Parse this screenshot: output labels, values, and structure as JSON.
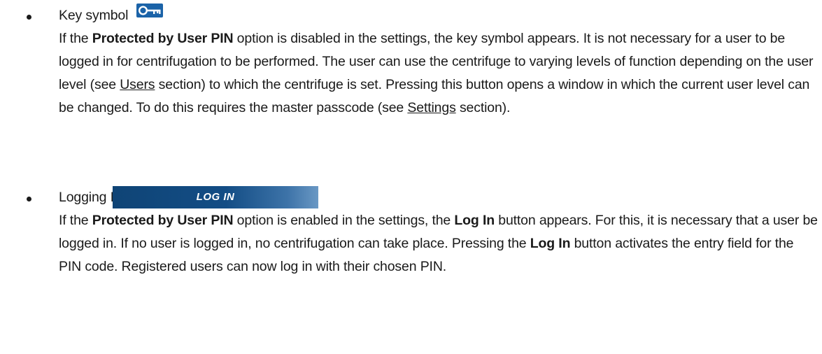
{
  "items": [
    {
      "title": "Key symbol",
      "icon": "key-icon",
      "paragraph": [
        {
          "text": "If the "
        },
        {
          "text": "Protected by User PIN",
          "bold": true
        },
        {
          "text": " option is disabled in the settings, the key symbol appears. It is not necessary for a user to be logged in for centrifugation to be performed. The user can use the centrifuge to varying levels of function depending on the user level (see "
        },
        {
          "text": "Users",
          "underline": true
        },
        {
          "text": " section) to which the centrifuge is set. Pressing this button opens a window in which the current user level can be changed. To do this requires the master passcode (see "
        },
        {
          "text": "Settings",
          "underline": true
        },
        {
          "text": " section)."
        }
      ]
    },
    {
      "title": "Logging In",
      "button_label": "LOG IN",
      "paragraph": [
        {
          "text": "If the "
        },
        {
          "text": "Protected by User PIN",
          "bold": true
        },
        {
          "text": " option is enabled in the settings, the "
        },
        {
          "text": "Log In",
          "bold": true
        },
        {
          "text": " button appears. For this, it is necessary that a user be logged in. If no user is logged in, no centrifugation can take place. Pressing the "
        },
        {
          "text": "Log In",
          "bold": true
        },
        {
          "text": " button activates the entry field for the PIN code. Registered users can now log in with their chosen PIN."
        }
      ]
    }
  ],
  "colors": {
    "text": "#1a1a1a",
    "key_icon_bg": "#1b63a8",
    "button_bg": "#134d85",
    "button_text": "#ffffff"
  }
}
